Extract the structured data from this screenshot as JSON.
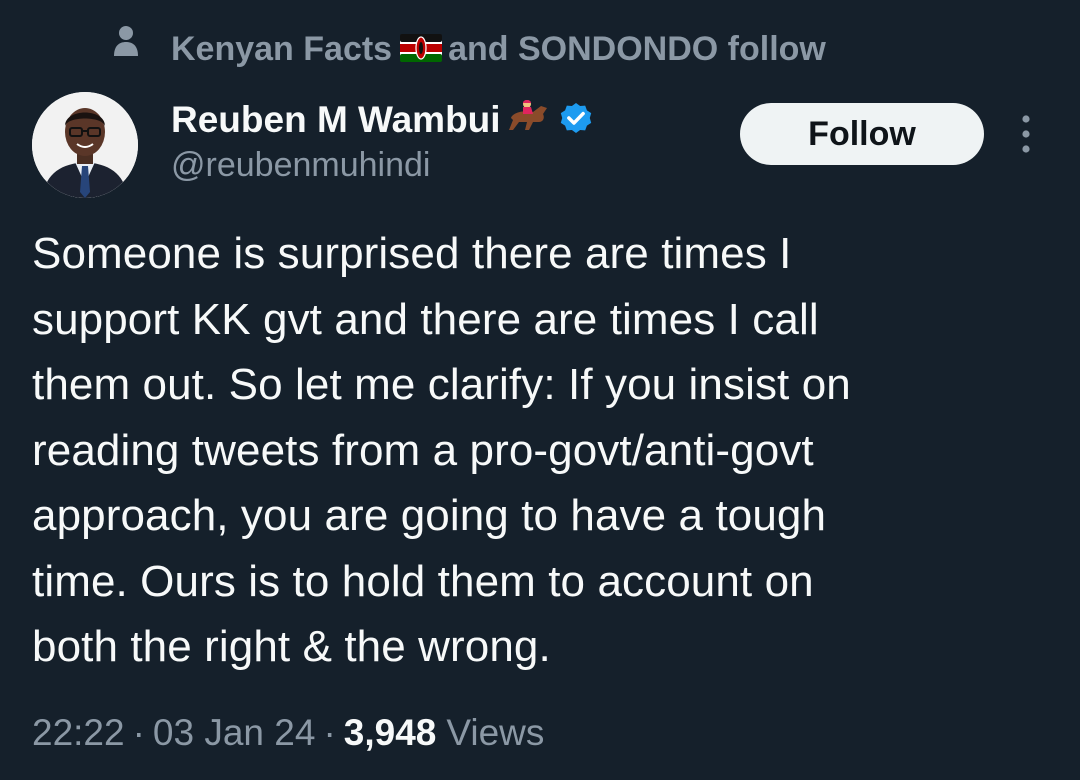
{
  "social_context": {
    "icon": "person-icon",
    "text_before_flag": "Kenyan Facts",
    "flag_icon": "kenya-flag-icon",
    "text_after_flag": "and SONDONDO follow"
  },
  "author": {
    "display_name": "Reuben M Wambui",
    "name_emoji": "horse-racing-emoji",
    "verified_icon": "verified-badge-icon",
    "handle": "@reubenmuhindi",
    "avatar": "avatar-photo"
  },
  "actions": {
    "follow_label": "Follow",
    "more_icon": "more-vertical-icon"
  },
  "tweet": {
    "text": "Someone is surprised there are times I\nsupport KK gvt and there are times I call\nthem out. So let me clarify: If you insist on\nreading tweets from a pro-govt/anti-govt\napproach, you are going to have a tough\ntime. Ours is to hold them to account on\nboth the right & the wrong."
  },
  "meta": {
    "time": "22:22",
    "separator": "·",
    "date": "03 Jan 24",
    "views_count": "3,948",
    "views_label": "Views"
  },
  "colors": {
    "background": "#15202b",
    "primary_text": "#f7f9f9",
    "secondary_text": "#8b98a5",
    "follow_bg": "#eff3f4",
    "verified": "#1d9bf0"
  }
}
